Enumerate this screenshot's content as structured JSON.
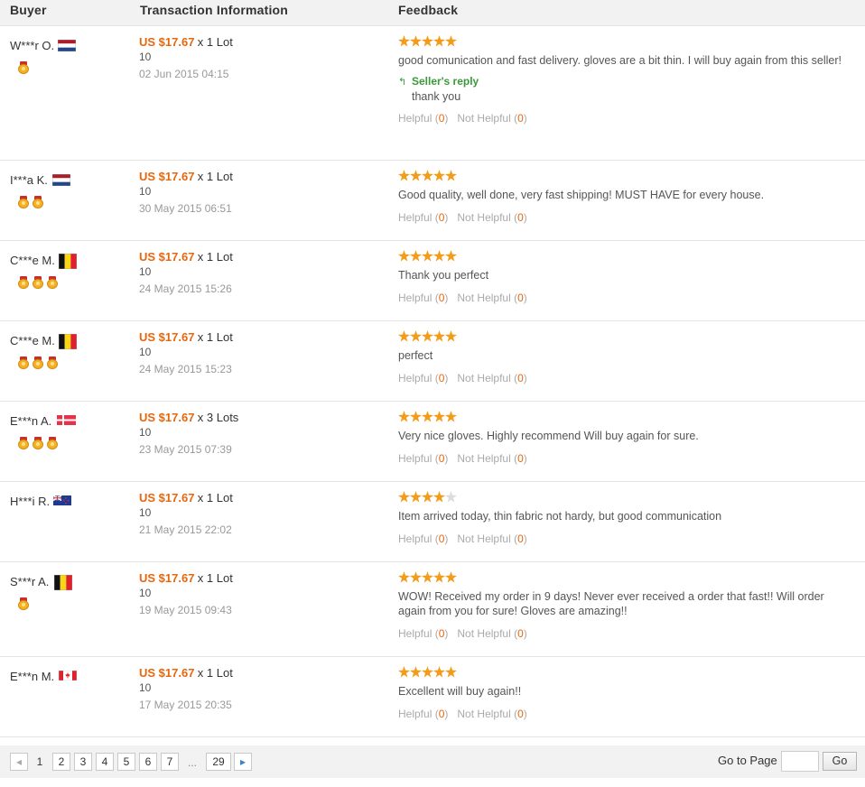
{
  "headers": {
    "buyer": "Buyer",
    "transaction": "Transaction Information",
    "feedback": "Feedback"
  },
  "reviews": [
    {
      "buyer": "W***r O.",
      "country_flag": "netherlands-flag",
      "medal_count": 1,
      "price": "US $17.67",
      "qty": "x 1 Lot",
      "line2": "10",
      "date": "02 Jun 2015 04:15",
      "stars": 5,
      "text": "good comunication and fast delivery. gloves are a bit thin. I will buy again from this seller!",
      "reply_label": "Seller's reply",
      "reply_text": "thank you",
      "helpful_label": "Helpful",
      "helpful_count": "0",
      "not_helpful_label": "Not Helpful",
      "not_helpful_count": "0"
    },
    {
      "buyer": "I***a K.",
      "country_flag": "netherlands-flag",
      "medal_count": 2,
      "price": "US $17.67",
      "qty": "x 1 Lot",
      "line2": "10",
      "date": "30 May 2015 06:51",
      "stars": 5,
      "text": "Good quality, well done, very fast shipping! MUST HAVE for every house.",
      "helpful_label": "Helpful",
      "helpful_count": "0",
      "not_helpful_label": "Not Helpful",
      "not_helpful_count": "0"
    },
    {
      "buyer": "C***e M.",
      "country_flag": "belgium-flag",
      "medal_count": 3,
      "price": "US $17.67",
      "qty": "x 1 Lot",
      "line2": "10",
      "date": "24 May 2015 15:26",
      "stars": 5,
      "text": "Thank you perfect",
      "helpful_label": "Helpful",
      "helpful_count": "0",
      "not_helpful_label": "Not Helpful",
      "not_helpful_count": "0"
    },
    {
      "buyer": "C***e M.",
      "country_flag": "belgium-flag",
      "medal_count": 3,
      "price": "US $17.67",
      "qty": "x 1 Lot",
      "line2": "10",
      "date": "24 May 2015 15:23",
      "stars": 5,
      "text": "perfect",
      "helpful_label": "Helpful",
      "helpful_count": "0",
      "not_helpful_label": "Not Helpful",
      "not_helpful_count": "0"
    },
    {
      "buyer": "E***n A.",
      "country_flag": "denmark-flag",
      "medal_count": 3,
      "price": "US $17.67",
      "qty": "x 3 Lots",
      "line2": "10",
      "date": "23 May 2015 07:39",
      "stars": 5,
      "text": "Very nice gloves. Highly recommend Will buy again for sure.",
      "helpful_label": "Helpful",
      "helpful_count": "0",
      "not_helpful_label": "Not Helpful",
      "not_helpful_count": "0"
    },
    {
      "buyer": "H***i R.",
      "country_flag": "new-zealand-flag",
      "medal_count": 0,
      "price": "US $17.67",
      "qty": "x 1 Lot",
      "line2": "10",
      "date": "21 May 2015 22:02",
      "stars": 4,
      "text": "Item arrived today, thin fabric not hardy, but good communication",
      "helpful_label": "Helpful",
      "helpful_count": "0",
      "not_helpful_label": "Not Helpful",
      "not_helpful_count": "0"
    },
    {
      "buyer": "S***r A.",
      "country_flag": "belgium-flag",
      "medal_count": 1,
      "price": "US $17.67",
      "qty": "x 1 Lot",
      "line2": "10",
      "date": "19 May 2015 09:43",
      "stars": 5,
      "text": "WOW! Received my order in 9 days! Never ever received a order that fast!! Will order again from you for sure! Gloves are amazing!!",
      "helpful_label": "Helpful",
      "helpful_count": "0",
      "not_helpful_label": "Not Helpful",
      "not_helpful_count": "0"
    },
    {
      "buyer": "E***n M.",
      "country_flag": "canada-flag",
      "medal_count": 0,
      "price": "US $17.67",
      "qty": "x 1 Lot",
      "line2": "10",
      "date": "17 May 2015 20:35",
      "stars": 5,
      "text": "Excellent will buy again!!",
      "helpful_label": "Helpful",
      "helpful_count": "0",
      "not_helpful_label": "Not Helpful",
      "not_helpful_count": "0"
    }
  ],
  "pagination": {
    "prev_icon": "chevron-left-icon",
    "next_icon": "chevron-right-icon",
    "pages": [
      "1",
      "2",
      "3",
      "4",
      "5",
      "6",
      "7"
    ],
    "current": "1",
    "ellipsis": "...",
    "last": "29",
    "goto_label": "Go to Page",
    "goto_value": "",
    "go_button": "Go"
  },
  "colors": {
    "price": "#e8660c",
    "star": "#f39c1a",
    "reply": "#3a9a3a",
    "header_bg": "#f2f2f2"
  }
}
